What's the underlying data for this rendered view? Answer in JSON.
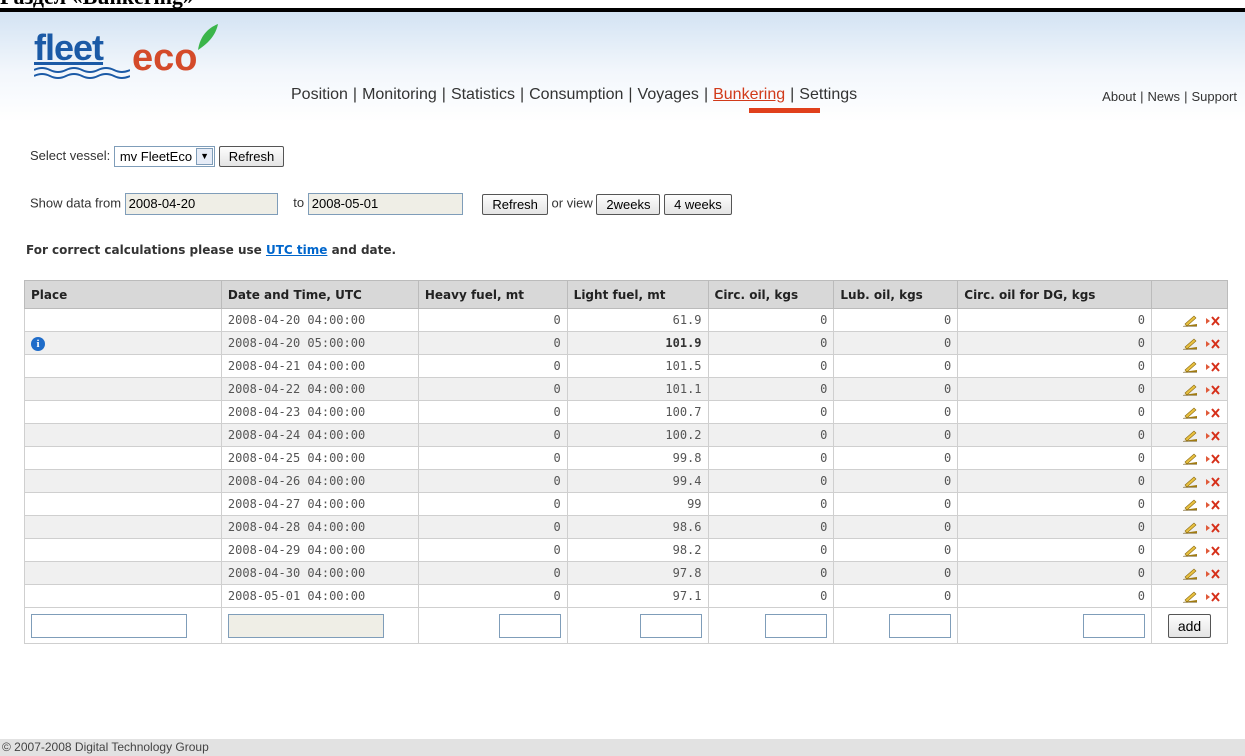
{
  "doc_heading": "Раздел «Bunkering»",
  "logo": {
    "part1": "fleet",
    "part2": "eco"
  },
  "nav": {
    "items": [
      "Position",
      "Monitoring",
      "Statistics",
      "Consumption",
      "Voyages",
      "Bunkering",
      "Settings"
    ],
    "active": "Bunkering",
    "right_items": [
      "About",
      "News",
      "Support"
    ]
  },
  "vessel": {
    "label": "Select vessel:",
    "selected": "mv FleetEco",
    "refresh_label": "Refresh"
  },
  "date_filter": {
    "label_from": "Show data from",
    "from_value": "2008-04-20",
    "label_to": "to",
    "to_value": "2008-05-01",
    "refresh_label": "Refresh",
    "or_view_label": "or view",
    "two_weeks_label": "2weeks",
    "four_weeks_label": "4 weeks"
  },
  "notice": {
    "before": "For correct calculations please use",
    "link": "UTC time",
    "after": "and date."
  },
  "table": {
    "headers": [
      "Place",
      "Date and Time, UTC",
      "Heavy fuel, mt",
      "Light fuel, mt",
      "Circ. oil, kgs",
      "Lub. oil, kgs",
      "Circ. oil for DG, kgs",
      ""
    ],
    "rows": [
      {
        "place": "",
        "datetime": "2008-04-20 04:00:00",
        "heavy": "0",
        "light": "61.9",
        "circ": "0",
        "lub": "0",
        "circ_dg": "0",
        "info": false,
        "bold": false
      },
      {
        "place": "",
        "datetime": "2008-04-20 05:00:00",
        "heavy": "0",
        "light": "101.9",
        "circ": "0",
        "lub": "0",
        "circ_dg": "0",
        "info": true,
        "bold": true
      },
      {
        "place": "",
        "datetime": "2008-04-21 04:00:00",
        "heavy": "0",
        "light": "101.5",
        "circ": "0",
        "lub": "0",
        "circ_dg": "0",
        "info": false,
        "bold": false
      },
      {
        "place": "",
        "datetime": "2008-04-22 04:00:00",
        "heavy": "0",
        "light": "101.1",
        "circ": "0",
        "lub": "0",
        "circ_dg": "0",
        "info": false,
        "bold": false
      },
      {
        "place": "",
        "datetime": "2008-04-23 04:00:00",
        "heavy": "0",
        "light": "100.7",
        "circ": "0",
        "lub": "0",
        "circ_dg": "0",
        "info": false,
        "bold": false
      },
      {
        "place": "",
        "datetime": "2008-04-24 04:00:00",
        "heavy": "0",
        "light": "100.2",
        "circ": "0",
        "lub": "0",
        "circ_dg": "0",
        "info": false,
        "bold": false
      },
      {
        "place": "",
        "datetime": "2008-04-25 04:00:00",
        "heavy": "0",
        "light": "99.8",
        "circ": "0",
        "lub": "0",
        "circ_dg": "0",
        "info": false,
        "bold": false
      },
      {
        "place": "",
        "datetime": "2008-04-26 04:00:00",
        "heavy": "0",
        "light": "99.4",
        "circ": "0",
        "lub": "0",
        "circ_dg": "0",
        "info": false,
        "bold": false
      },
      {
        "place": "",
        "datetime": "2008-04-27 04:00:00",
        "heavy": "0",
        "light": "99",
        "circ": "0",
        "lub": "0",
        "circ_dg": "0",
        "info": false,
        "bold": false
      },
      {
        "place": "",
        "datetime": "2008-04-28 04:00:00",
        "heavy": "0",
        "light": "98.6",
        "circ": "0",
        "lub": "0",
        "circ_dg": "0",
        "info": false,
        "bold": false
      },
      {
        "place": "",
        "datetime": "2008-04-29 04:00:00",
        "heavy": "0",
        "light": "98.2",
        "circ": "0",
        "lub": "0",
        "circ_dg": "0",
        "info": false,
        "bold": false
      },
      {
        "place": "",
        "datetime": "2008-04-30 04:00:00",
        "heavy": "0",
        "light": "97.8",
        "circ": "0",
        "lub": "0",
        "circ_dg": "0",
        "info": false,
        "bold": false
      },
      {
        "place": "",
        "datetime": "2008-05-01 04:00:00",
        "heavy": "0",
        "light": "97.1",
        "circ": "0",
        "lub": "0",
        "circ_dg": "0",
        "info": false,
        "bold": false
      }
    ],
    "add_label": "add"
  },
  "icons": {
    "row_info": "info-icon",
    "edit": "edit-icon",
    "delete": "delete-icon"
  },
  "colors": {
    "accent": "#e0401c",
    "link": "#0066cc",
    "brand_blue": "#1b5aa6",
    "brand_green": "#3bb54a"
  },
  "footer": {
    "copyright": "© 2007-2008 Digital Technology Group"
  }
}
